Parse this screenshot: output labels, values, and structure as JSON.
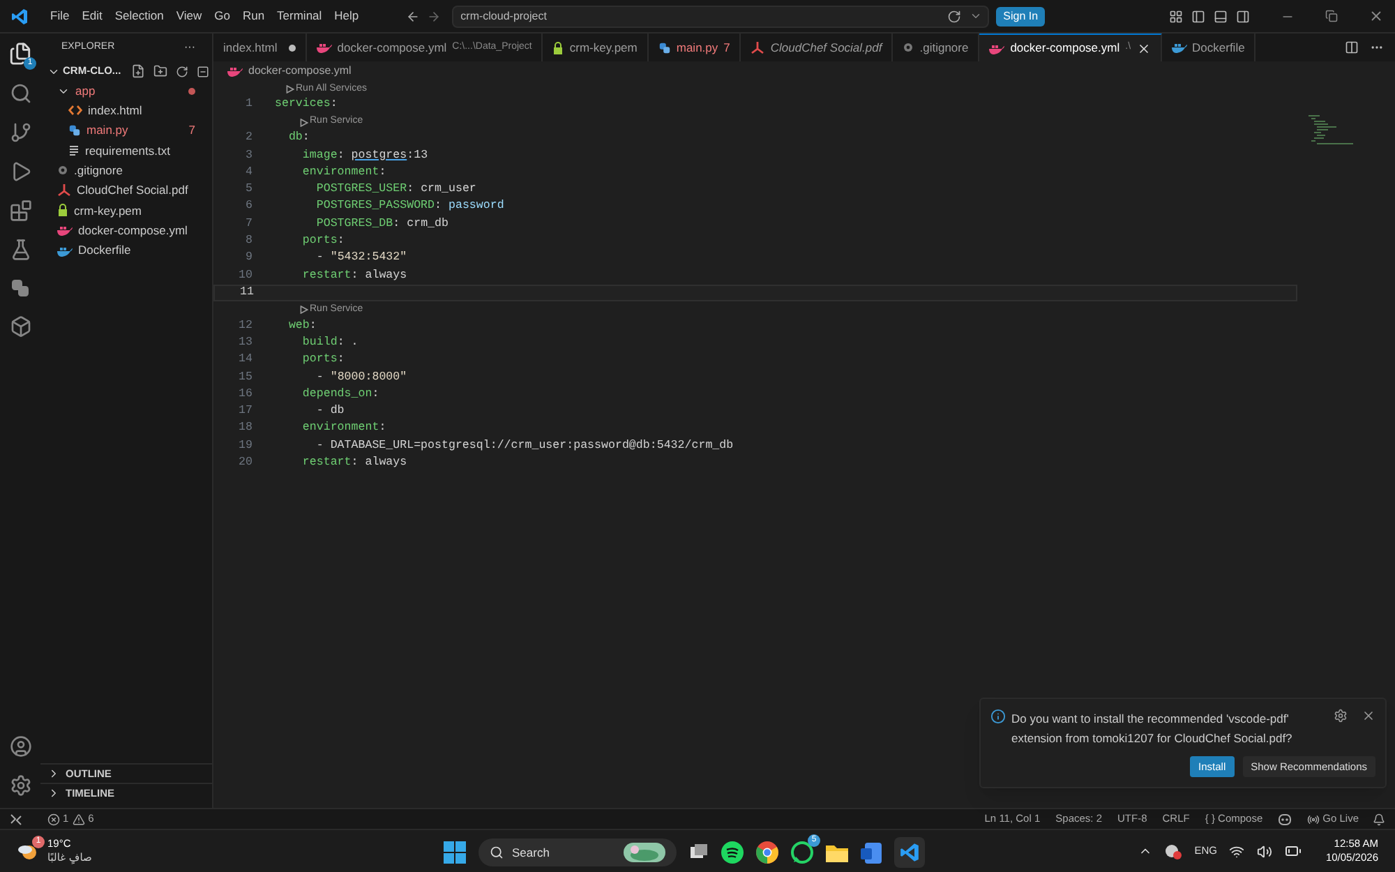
{
  "menu": [
    "File",
    "Edit",
    "Selection",
    "View",
    "Go",
    "Run",
    "Terminal",
    "Help"
  ],
  "command_center": "crm-cloud-project",
  "sign_in": "Sign In",
  "activity_badge": "1",
  "explorer": {
    "title": "EXPLORER",
    "more": "···",
    "root": "CRM-CLO...",
    "expanded": true,
    "items": [
      {
        "name": "app",
        "kind": "folder",
        "expanded": true,
        "modified": true,
        "children": [
          {
            "name": "index.html",
            "kind": "html"
          },
          {
            "name": "main.py",
            "kind": "python",
            "problems": "7"
          },
          {
            "name": "requirements.txt",
            "kind": "text"
          }
        ]
      },
      {
        "name": ".gitignore",
        "kind": "git"
      },
      {
        "name": "CloudChef Social.pdf",
        "kind": "pdf"
      },
      {
        "name": "crm-key.pem",
        "kind": "key"
      },
      {
        "name": "docker-compose.yml",
        "kind": "docker"
      },
      {
        "name": "Dockerfile",
        "kind": "dockerfile"
      }
    ]
  },
  "panels": [
    {
      "label": "OUTLINE",
      "expanded": false
    },
    {
      "label": "TIMELINE",
      "expanded": false
    }
  ],
  "tabs": [
    {
      "label": "index.html",
      "kind": "plain",
      "dirty": true,
      "selected": false
    },
    {
      "label": "docker-compose.yml",
      "kind": "docker",
      "description": "C:\\...\\Data_Project",
      "selected": false
    },
    {
      "label": "crm-key.pem",
      "kind": "key",
      "selected": false
    },
    {
      "label": "main.py",
      "kind": "python",
      "problems": "7",
      "selected": false
    },
    {
      "label": "CloudChef Social.pdf",
      "kind": "pdf",
      "preview": true,
      "selected": false
    },
    {
      "label": ".gitignore",
      "kind": "git",
      "selected": false
    },
    {
      "label": "docker-compose.yml",
      "kind": "docker",
      "description": ".\\",
      "selected": true
    },
    {
      "label": "Dockerfile",
      "kind": "dockerfile",
      "selected": false
    }
  ],
  "breadcrumb": "docker-compose.yml",
  "code": [
    {
      "n": "1",
      "lens": "Run All Services",
      "tokens": [
        {
          "t": "services",
          "kind": "key"
        },
        {
          "t": ":",
          "kind": "text"
        }
      ]
    },
    {
      "n": "2",
      "lens": "Run Service",
      "tokens": [
        {
          "t": "  db",
          "kind": "key"
        },
        {
          "t": ":",
          "kind": "text"
        }
      ]
    },
    {
      "n": "3",
      "tokens": [
        {
          "t": "    image",
          "kind": "key"
        },
        {
          "t": ": ",
          "kind": "text"
        },
        {
          "t": "postgres",
          "kind": "link"
        },
        {
          "t": ":13",
          "kind": "text"
        }
      ]
    },
    {
      "n": "4",
      "tokens": [
        {
          "t": "    environment",
          "kind": "key"
        },
        {
          "t": ":",
          "kind": "text"
        }
      ]
    },
    {
      "n": "5",
      "tokens": [
        {
          "t": "      POSTGRES_USER",
          "kind": "key"
        },
        {
          "t": ": crm_user",
          "kind": "text"
        }
      ]
    },
    {
      "n": "6",
      "tokens": [
        {
          "t": "      POSTGRES_PASSWORD",
          "kind": "key"
        },
        {
          "t": ": ",
          "kind": "text"
        },
        {
          "t": "password",
          "kind": "value"
        }
      ]
    },
    {
      "n": "7",
      "tokens": [
        {
          "t": "      POSTGRES_DB",
          "kind": "key"
        },
        {
          "t": ": crm_db",
          "kind": "text"
        }
      ]
    },
    {
      "n": "8",
      "tokens": [
        {
          "t": "    ports",
          "kind": "key"
        },
        {
          "t": ":",
          "kind": "text"
        }
      ]
    },
    {
      "n": "9",
      "tokens": [
        {
          "t": "      - ",
          "kind": "text"
        },
        {
          "t": "\"5432:5432\"",
          "kind": "string"
        }
      ]
    },
    {
      "n": "10",
      "tokens": [
        {
          "t": "    restart",
          "kind": "key"
        },
        {
          "t": ": always",
          "kind": "text"
        }
      ]
    },
    {
      "n": "11",
      "current": true
    },
    {
      "n": "12",
      "lens": "Run Service",
      "tokens": [
        {
          "t": "  web",
          "kind": "key"
        },
        {
          "t": ":",
          "kind": "text"
        }
      ]
    },
    {
      "n": "13",
      "tokens": [
        {
          "t": "    build",
          "kind": "key"
        },
        {
          "t": ": .",
          "kind": "text"
        }
      ]
    },
    {
      "n": "14",
      "tokens": [
        {
          "t": "    ports",
          "kind": "key"
        },
        {
          "t": ":",
          "kind": "text"
        }
      ]
    },
    {
      "n": "15",
      "tokens": [
        {
          "t": "      - ",
          "kind": "text"
        },
        {
          "t": "\"8000:8000\"",
          "kind": "string"
        }
      ]
    },
    {
      "n": "16",
      "tokens": [
        {
          "t": "    depends_on",
          "kind": "key"
        },
        {
          "t": ":",
          "kind": "text"
        }
      ]
    },
    {
      "n": "17",
      "tokens": [
        {
          "t": "      - db",
          "kind": "text"
        }
      ]
    },
    {
      "n": "18",
      "tokens": [
        {
          "t": "    environment",
          "kind": "key"
        },
        {
          "t": ":",
          "kind": "text"
        }
      ]
    },
    {
      "n": "19",
      "tokens": [
        {
          "t": "      - DATABASE_URL=postgresql://crm_user:password@db:5432/crm_db",
          "kind": "text"
        }
      ]
    },
    {
      "n": "20",
      "tokens": [
        {
          "t": "    restart",
          "kind": "key"
        },
        {
          "t": ": always",
          "kind": "text"
        }
      ]
    }
  ],
  "notification": {
    "message": "Do you want to install the recommended 'vscode-pdf' extension from tomoki1207 for CloudChef Social.pdf?",
    "primary": "Install",
    "secondary": "Show Recommendations"
  },
  "status_bar": {
    "errors": "1",
    "warnings": "6",
    "right": [
      "Ln 11, Col 1",
      "Spaces: 2",
      "UTF-8",
      "CRLF",
      "{ } Compose"
    ],
    "go_live": "Go Live"
  },
  "taskbar": {
    "temperature": "19°C",
    "weather": "صافٍ غالبًا",
    "weather_badge": "1",
    "search": "Search",
    "whatsapp_badge": "5",
    "language": "ENG",
    "time": "12:58 AM",
    "date": "10/05/2026"
  }
}
